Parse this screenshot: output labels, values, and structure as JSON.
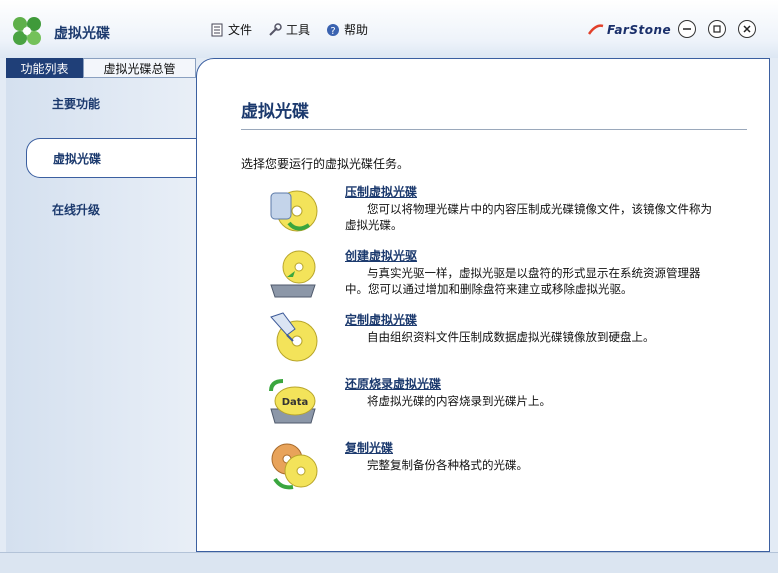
{
  "window": {
    "title": "虚拟光碟",
    "brand": "FarStone"
  },
  "menu": [
    {
      "label": "文件"
    },
    {
      "label": "工具"
    },
    {
      "label": "帮助"
    }
  ],
  "tabs": [
    {
      "label": "功能列表"
    },
    {
      "label": "虚拟光碟总管"
    }
  ],
  "sidebar": {
    "items": [
      {
        "label": "主要功能"
      },
      {
        "label": "虚拟光碟"
      },
      {
        "label": "在线升级"
      }
    ]
  },
  "main": {
    "title": "虚拟光碟",
    "intro": "选择您要运行的虚拟光碟任务。",
    "tasks": [
      {
        "title": "压制虚拟光碟",
        "desc": "您可以将物理光碟片中的内容压制成光碟镜像文件，该镜像文件称为虚拟光碟。"
      },
      {
        "title": "创建虚拟光驱",
        "desc": "与真实光驱一样，虚拟光驱是以盘符的形式显示在系统资源管理器中。您可以通过增加和删除盘符来建立或移除虚拟光驱。"
      },
      {
        "title": "定制虚拟光碟",
        "desc": "自由组织资料文件压制成数据虚拟光碟镜像放到硬盘上。"
      },
      {
        "title": "还原烧录虚拟光碟",
        "desc": "将虚拟光碟的内容烧录到光碟片上。",
        "icon_label": "Data"
      },
      {
        "title": "复制光碟",
        "desc": "完整复制备份各种格式的光碟。"
      }
    ]
  }
}
